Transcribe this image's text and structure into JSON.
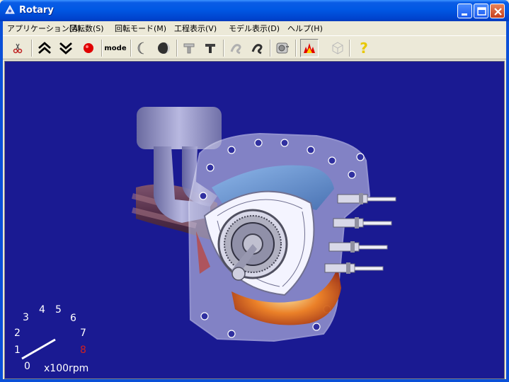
{
  "window": {
    "title": "Rotary"
  },
  "menu": [
    {
      "label": "アプリケーション(A)"
    },
    {
      "label": "回転数(S)"
    },
    {
      "label": "回転モード(M)"
    },
    {
      "label": "工程表示(V)"
    },
    {
      "label": "モデル表示(D)"
    },
    {
      "label": "ヘルプ(H)"
    }
  ],
  "toolbar": {
    "mode_label": "mode",
    "help_glyph": "?"
  },
  "gauge": {
    "ticks": [
      "0",
      "1",
      "2",
      "3",
      "4",
      "5",
      "6",
      "7",
      "8"
    ],
    "unit": "x100rpm",
    "redline_color": "#d02020"
  },
  "colors": {
    "viewport_bg": "#1a1a92",
    "title_bar": "#0058e3"
  }
}
